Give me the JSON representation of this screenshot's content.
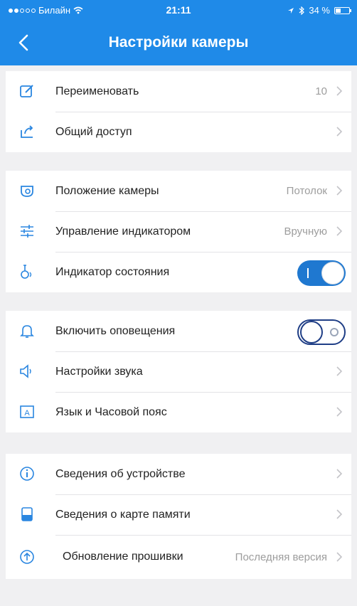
{
  "status_bar": {
    "carrier": "Билайн",
    "time": "21:11",
    "battery": "34 %"
  },
  "nav": {
    "title": "Настройки камеры"
  },
  "groups": [
    {
      "items": [
        {
          "label": "Переименовать",
          "value": "10",
          "icon": "edit-icon"
        },
        {
          "label": "Общий доступ",
          "value": "",
          "icon": "share-icon"
        }
      ]
    },
    {
      "items": [
        {
          "label": "Положение камеры",
          "value": "Потолок",
          "icon": "camera-position-icon"
        },
        {
          "label": "Управление индикатором",
          "value": "Вручную",
          "icon": "sliders-icon"
        },
        {
          "label": "Индикатор состояния",
          "toggle": true,
          "icon": "indicator-icon"
        }
      ]
    },
    {
      "items": [
        {
          "label": "Включить оповещения",
          "toggle": false,
          "icon": "bell-icon"
        },
        {
          "label": "Настройки звука",
          "value": "",
          "icon": "speaker-icon"
        },
        {
          "label": "Язык и Часовой пояс",
          "value": "",
          "icon": "language-icon"
        }
      ]
    },
    {
      "items": [
        {
          "label": "Сведения об устройстве",
          "value": "",
          "icon": "info-icon"
        },
        {
          "label": "Сведения о карте памяти",
          "value": "",
          "icon": "sd-card-icon"
        },
        {
          "label": "Обновление прошивки",
          "value": "Последняя версия",
          "icon": "upload-icon"
        }
      ]
    }
  ],
  "colors": {
    "accent": "#1f8ae8",
    "toggle_on": "#1f78d0",
    "background": "#f0f0f2"
  }
}
